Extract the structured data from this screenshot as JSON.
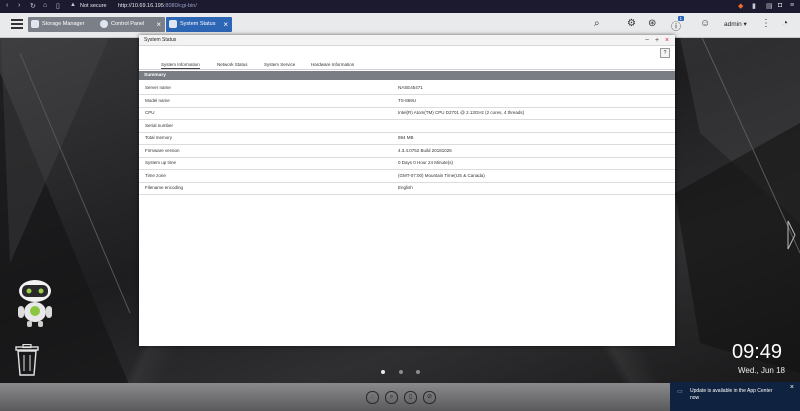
{
  "browser": {
    "security_label": "Not secure",
    "url_host": "http://10.69.16.195",
    "url_path": ":8080/cgi-bin/"
  },
  "taskbar": {
    "tabs": [
      {
        "label": "Storage Manager"
      },
      {
        "label": "Control Panel"
      },
      {
        "label": "System Status"
      }
    ],
    "user": "admin ▾",
    "notification_count": "1"
  },
  "window": {
    "title": "System Status",
    "help_label": "?",
    "tabs": [
      {
        "label": "System Information"
      },
      {
        "label": "Network Status"
      },
      {
        "label": "System Service"
      },
      {
        "label": "Hardware Information"
      }
    ],
    "section": "Summary",
    "rows": [
      {
        "key": "Server name",
        "value": "NASE45471"
      },
      {
        "key": "Model name",
        "value": "TS-869U"
      },
      {
        "key": "CPU",
        "value": "Intel(R) Atom(TM) CPU D2701 @ 2.13GHz (2 cores, 4 threads)"
      },
      {
        "key": "Serial number",
        "value": ""
      },
      {
        "key": "Total memory",
        "value": "984 MB"
      },
      {
        "key": "Firmware version",
        "value": "4.3.4.0752 Build 20181026"
      },
      {
        "key": "System up time",
        "value": "0 Days 0 Hour 24 Minute(s)"
      },
      {
        "key": "Time zone",
        "value": "(GMT-07:00) Mountain Time(US & Canada)"
      },
      {
        "key": "Filename encoding",
        "value": "English"
      }
    ]
  },
  "desktop": {
    "time": "09:49",
    "date": "Wed., Jun 18"
  },
  "notification": {
    "text": "Update is available in the App Center now"
  },
  "colors": {
    "accent": "#2d66b5",
    "summary_bar": "#7a7d83",
    "notify_bg": "#0f2340"
  }
}
